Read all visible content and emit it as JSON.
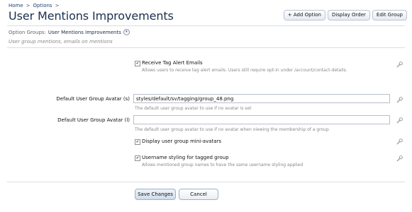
{
  "breadcrumb": {
    "home": "Home",
    "sep1": ">",
    "options": "Options",
    "sep2": ">"
  },
  "page": {
    "title": "User Mentions Improvements",
    "subtitle": "User group mentions, emails on mentions"
  },
  "toolbar": {
    "add_option": "+ Add Option",
    "display_order": "Display Order",
    "edit_group": "Edit Group"
  },
  "option_groups": {
    "label": "Option Groups:",
    "value": "User Mentions Improvements"
  },
  "options": {
    "receive_tag_alert": {
      "checked": true,
      "label": "Receive Tag Alert Emails",
      "explain": "Allows users to receive tag alert emails. Users still require opt-in under /account/contact-details."
    },
    "avatar_s": {
      "label": "Default User Group Avatar (s)",
      "value": "styles/default/sv/tagging/group_48.png",
      "explain": "The default user group avatar to use if no avatar is set"
    },
    "avatar_l": {
      "label": "Default User Group Avatar (l)",
      "value": "",
      "explain": "The default user group avatar to use if no avatar when viewing the membership of a group"
    },
    "mini_avatars": {
      "checked": true,
      "label": "Display user group mini-avatars"
    },
    "username_styling": {
      "checked": true,
      "label": "Username styling for tagged group",
      "explain": "Allows mentioned group names to have the same username styling applied"
    }
  },
  "buttons": {
    "save": "Save Changes",
    "cancel": "Cancel"
  }
}
